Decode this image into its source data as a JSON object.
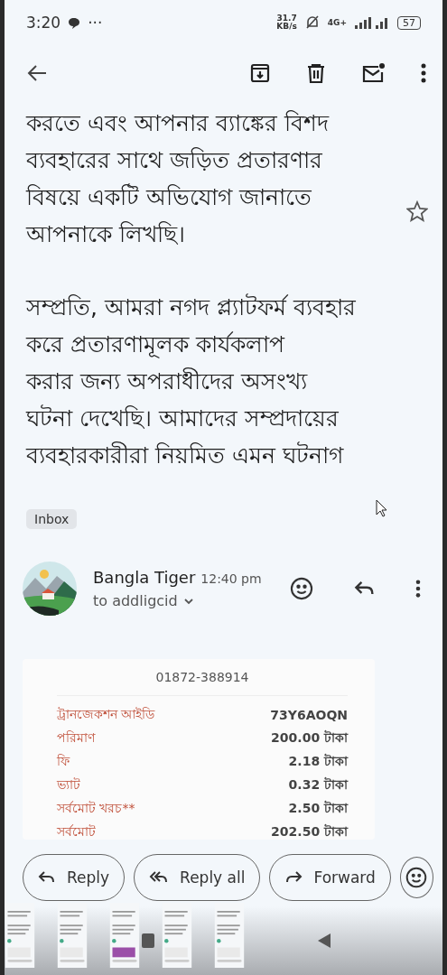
{
  "status_bar": {
    "time": "3:20",
    "dots": "···",
    "speed_value": "31.7",
    "speed_unit": "KB/s",
    "network": "4G+",
    "battery": "57"
  },
  "message": {
    "paragraphs": [
      [
        "করতে এবং আপনার ব্যাঙ্কের বিশদ",
        "ব্যবহারের সাথে জড়িত প্রতারণার",
        "বিষয়ে একটি অভিযোগ জানাতে",
        "আপনাকে লিখছি।"
      ],
      [
        "সম্প্রতি, আমরা নগদ প্ল্যাটফর্ম ব্যবহার",
        "করে প্রতারণামূলক কার্যকলাপ",
        "করার জন্য অপরাধীদের অসংখ্য",
        "ঘটনা দেখেছি। আমাদের সম্প্রদায়ের",
        "ব্যবহারকারীরা নিয়মিত এমন ঘটনাগ"
      ]
    ],
    "starred": false,
    "label": "Inbox"
  },
  "reply": {
    "sender": "Bangla Tiger",
    "time": "12:40 pm",
    "recipient": "to addligcid",
    "receipt": {
      "phone": "01872-388914",
      "rows": [
        {
          "label": "ট্রানজেকশন আইডি",
          "value": "73Y6AOQN"
        },
        {
          "label": "পরিমাণ",
          "value": "200.00 টাকা"
        },
        {
          "label": "ফি",
          "value": "2.18 টাকা"
        },
        {
          "label": "ভ্যাট",
          "value": "0.32 টাকা"
        },
        {
          "label": "সর্বমোট খরচ**",
          "value": "2.50 টাকা"
        },
        {
          "label": "সর্বমোট",
          "value": "202.50 টাকা"
        }
      ]
    }
  },
  "actions": [
    {
      "kind": "reply",
      "label": "Reply"
    },
    {
      "kind": "reply_all",
      "label": "Reply all"
    },
    {
      "kind": "forward",
      "label": "Forward"
    }
  ]
}
